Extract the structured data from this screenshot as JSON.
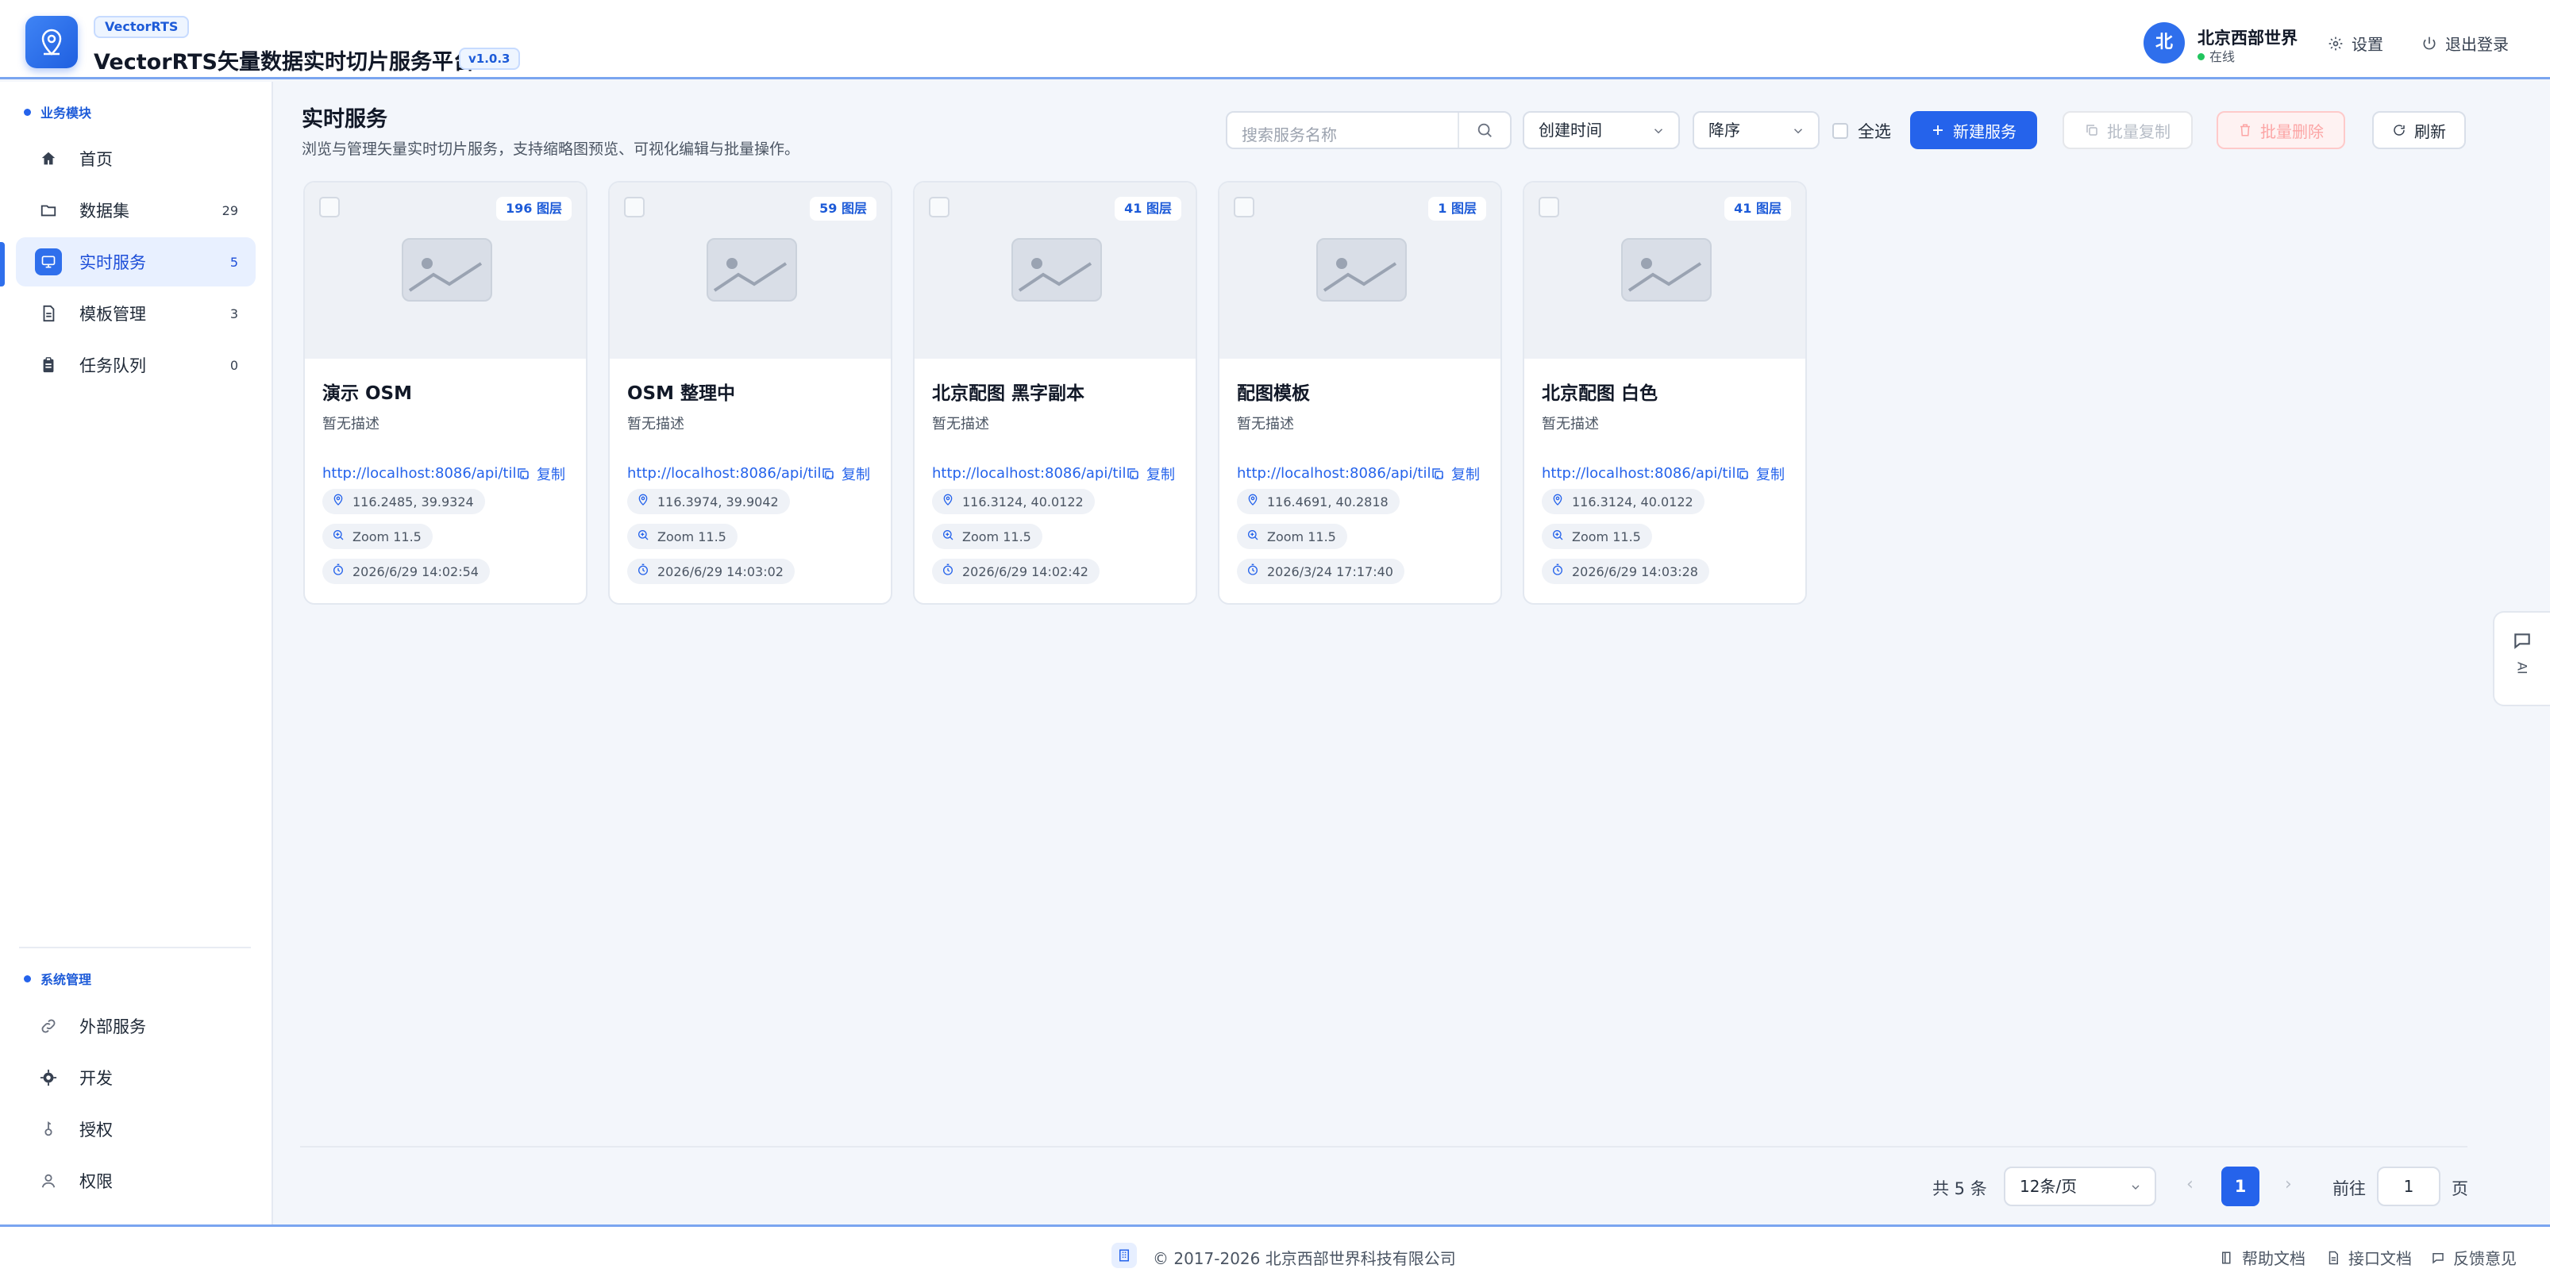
{
  "header": {
    "brand_tag": "VectorRTS",
    "title": "VectorRTS矢量数据实时切片服务平台",
    "version": "v1.0.3",
    "user_avatar_text": "北",
    "user_name": "北京西部世界",
    "user_status": "在线",
    "settings_label": "设置",
    "logout_label": "退出登录"
  },
  "sidebar": {
    "section_business": "业务模块",
    "items": [
      {
        "label": "首页",
        "count": "",
        "icon": "home-icon"
      },
      {
        "label": "数据集",
        "count": "29",
        "icon": "folder-icon"
      },
      {
        "label": "实时服务",
        "count": "5",
        "icon": "monitor-icon",
        "active": true
      },
      {
        "label": "模板管理",
        "count": "3",
        "icon": "file-icon"
      },
      {
        "label": "任务队列",
        "count": "0",
        "icon": "clipboard-icon"
      }
    ],
    "section_system": "系统管理",
    "system_items": [
      {
        "label": "外部服务",
        "icon": "link-icon"
      },
      {
        "label": "开发",
        "icon": "gear-icon"
      },
      {
        "label": "授权",
        "icon": "key-icon"
      },
      {
        "label": "权限",
        "icon": "user-icon"
      }
    ]
  },
  "main": {
    "title": "实时服务",
    "subtitle": "浏览与管理矢量实时切片服务，支持缩略图预览、可视化编辑与批量操作。",
    "search_placeholder": "搜索服务名称",
    "sort_field": "创建时间",
    "sort_order": "降序",
    "select_all_label": "全选",
    "new_service_label": "新建服务",
    "batch_copy_label": "批量复制",
    "batch_delete_label": "批量删除",
    "refresh_label": "刷新"
  },
  "cards": [
    {
      "layers": "196 图层",
      "title": "演示 OSM",
      "desc": "暂无描述",
      "url": "http://localhost:8086/api/til...",
      "copy": "复制",
      "center": "116.2485, 39.9324",
      "zoom": "Zoom 11.5",
      "time": "2026/6/29 14:02:54"
    },
    {
      "layers": "59 图层",
      "title": "OSM 整理中",
      "desc": "暂无描述",
      "url": "http://localhost:8086/api/til...",
      "copy": "复制",
      "center": "116.3974, 39.9042",
      "zoom": "Zoom 11.5",
      "time": "2026/6/29 14:03:02"
    },
    {
      "layers": "41 图层",
      "title": "北京配图 黑字副本",
      "desc": "暂无描述",
      "url": "http://localhost:8086/api/til...",
      "copy": "复制",
      "center": "116.3124, 40.0122",
      "zoom": "Zoom 11.5",
      "time": "2026/6/29 14:02:42"
    },
    {
      "layers": "1 图层",
      "title": "配图模板",
      "desc": "暂无描述",
      "url": "http://localhost:8086/api/til...",
      "copy": "复制",
      "center": "116.4691, 40.2818",
      "zoom": "Zoom 11.5",
      "time": "2026/3/24 17:17:40"
    },
    {
      "layers": "41 图层",
      "title": "北京配图 白色",
      "desc": "暂无描述",
      "url": "http://localhost:8086/api/til...",
      "copy": "复制",
      "center": "116.3124, 40.0122",
      "zoom": "Zoom 11.5",
      "time": "2026/6/29 14:03:28"
    }
  ],
  "pagination": {
    "total": "共 5 条",
    "page_size": "12条/页",
    "current": "1",
    "prev": "‹",
    "next": "›",
    "goto_label": "前往",
    "goto_value": "1",
    "page_suffix": "页"
  },
  "footer": {
    "copyright": "© 2017-2026 北京西部世界科技有限公司",
    "help_docs": "帮助文档",
    "api_docs": "接口文档",
    "feedback": "反馈意见"
  },
  "ai_float": {
    "label": "AI"
  },
  "colors": {
    "primary": "#2563eb",
    "header_border": "#7aa5f0",
    "danger_light": "#fca5a5"
  }
}
